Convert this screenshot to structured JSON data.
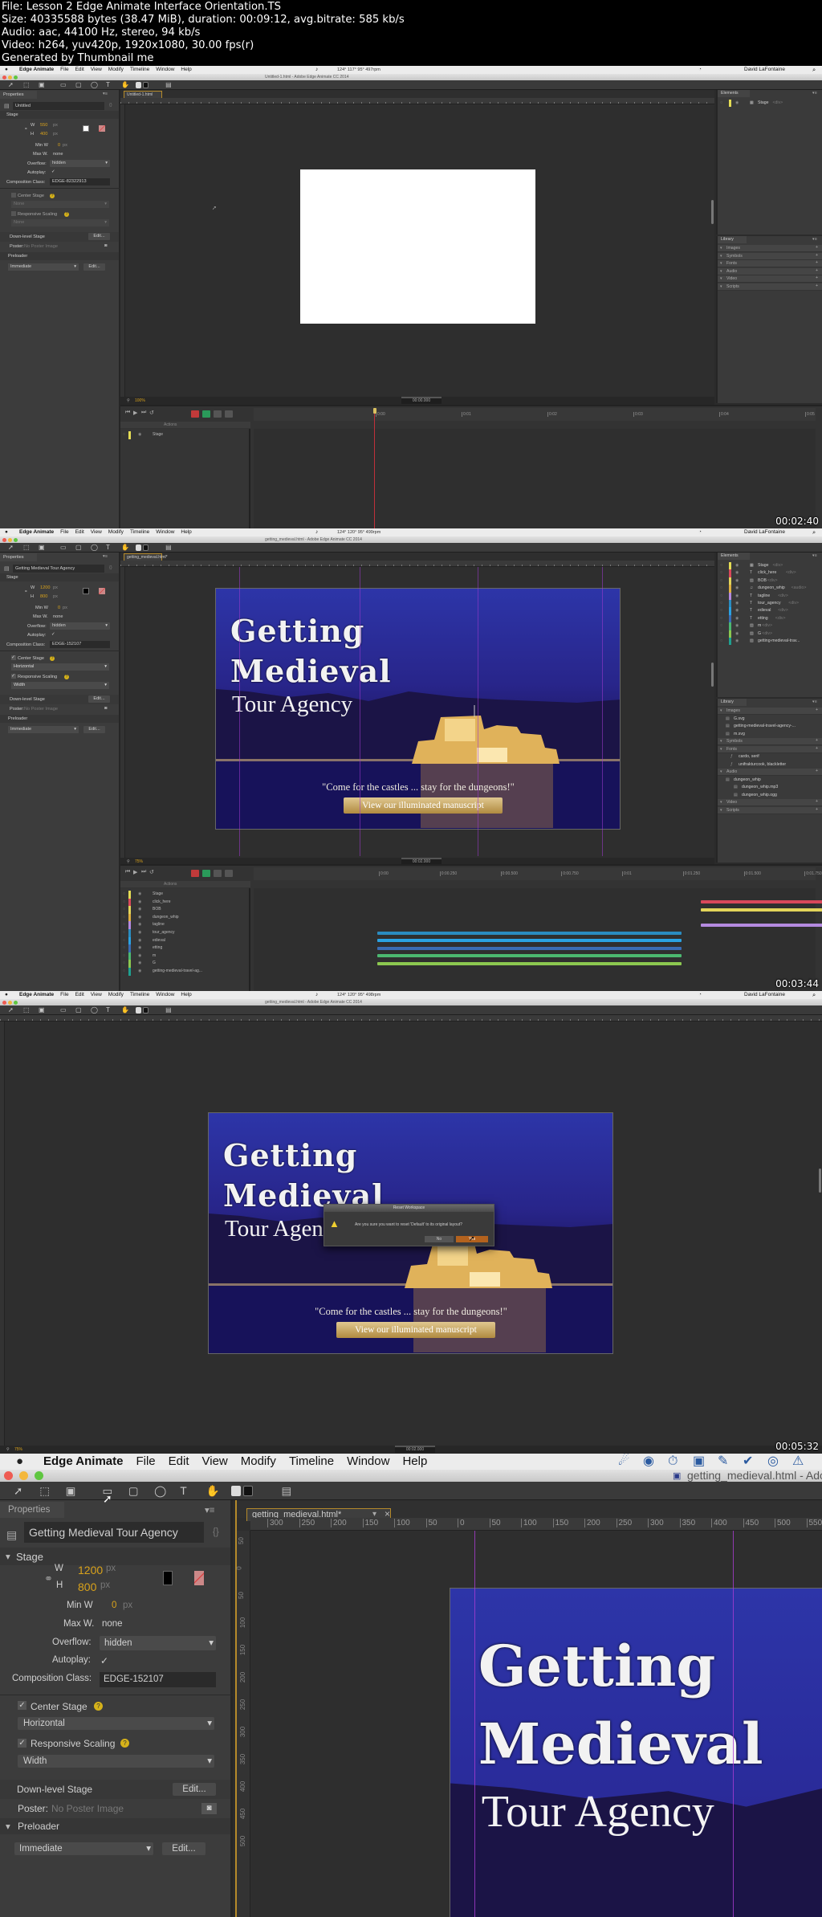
{
  "header": {
    "file": "File: Lesson 2 Edge Animate Interface Orientation.TS",
    "size": "Size: 40335588 bytes (38.47 MiB), duration: 00:09:12, avg.bitrate: 585 kb/s",
    "audio": "Audio: aac, 44100 Hz, stereo, 94 kb/s",
    "video": "Video: h264, yuv420p, 1920x1080, 30.00 fps(r)",
    "generator": "Generated by Thumbnail me"
  },
  "app": {
    "name": "Edge Animate",
    "menus": [
      "File",
      "Edit",
      "View",
      "Modify",
      "Timeline",
      "Window",
      "Help"
    ],
    "user": "David LaFontaine",
    "panel_properties": "Properties",
    "panel_elements": "Elements",
    "panel_library": "Library",
    "close_glyph": "×"
  },
  "labels": {
    "stage": "Stage",
    "w": "W",
    "h": "H",
    "px": "px",
    "min_w": "Min W",
    "max_w": "Max W.",
    "overflow": "Overflow:",
    "autoplay": "Autoplay:",
    "composition_class": "Composition Class:",
    "center_stage": "Center Stage",
    "responsive_scaling": "Responsive Scaling",
    "down_level_stage": "Down-level Stage",
    "poster": "Poster:",
    "no_poster": "No Poster Image",
    "preloader": "Preloader",
    "edit": "Edit...",
    "actions": "Actions",
    "check": "✓"
  },
  "stage_content": {
    "title_line1": "Getting",
    "title_line2": "Medieval",
    "subtitle": "Tour Agency",
    "tagline": "\"Come for the castles ... stay for the dungeons!\"",
    "button": "View our illuminated manuscript"
  },
  "colors": {
    "accent_orange": "#d9a21b",
    "guide_purple": "#a03ad0",
    "playhead_red": "#c0303a",
    "panel_bg": "#3c3c3c",
    "canvas_bg": "#2e2e2e"
  },
  "frames": [
    {
      "timestamp": "00:02:40",
      "status_readout": "124° 117° 95° 497rpm",
      "window_title": "Untitled-1.html - Adobe Edge Animate CC 2014",
      "doc_tab": "Untitled-1.html",
      "zoom": "100%",
      "time": "00:00.000",
      "properties": {
        "title": "Untitled",
        "w": "550",
        "h": "400",
        "min_w": "0",
        "max_w": "none",
        "overflow": "hidden",
        "autoplay": true,
        "composition_class": "EDGE-82322913",
        "center_stage": false,
        "center_stage_value": "None",
        "responsive_scaling": false,
        "responsive_scaling_value": "None",
        "preloader": "Immediate",
        "stage_color": "#ffffff"
      },
      "elements": [
        {
          "name": "Stage",
          "tag": "<div>",
          "color": "#e4dc55",
          "type": "stage"
        }
      ],
      "library": [
        {
          "label": "Images",
          "items": []
        },
        {
          "label": "Symbols",
          "items": []
        },
        {
          "label": "Fonts",
          "items": []
        },
        {
          "label": "Audio",
          "items": []
        },
        {
          "label": "Video",
          "items": []
        },
        {
          "label": "Scripts",
          "items": []
        }
      ],
      "timeline": {
        "ticks": [
          {
            "label": "0:00",
            "t": 0
          },
          {
            "label": "0:01",
            "t": 1
          },
          {
            "label": "0:02",
            "t": 2
          },
          {
            "label": "0:03",
            "t": 3
          },
          {
            "label": "0:04",
            "t": 4
          },
          {
            "label": "0:05",
            "t": 5
          },
          {
            "label": "0:06",
            "t": 6
          }
        ],
        "playhead": 0,
        "rows": [
          {
            "name": "Stage",
            "color": "#e4dc55",
            "bars": []
          }
        ]
      }
    },
    {
      "timestamp": "00:03:44",
      "status_readout": "124° 120° 95° 499rpm",
      "window_title": "getting_medieval.html - Adobe Edge Animate CC 2014",
      "doc_tab": "getting_medieval.html*",
      "zoom": "75%",
      "time": "00:02.000",
      "properties": {
        "title": "Getting Medieval Tour Agency",
        "w": "1200",
        "h": "800",
        "min_w": "0",
        "max_w": "none",
        "overflow": "hidden",
        "autoplay": true,
        "composition_class": "EDGE-152107",
        "center_stage": true,
        "center_stage_value": "Horizontal",
        "responsive_scaling": true,
        "responsive_scaling_value": "Width",
        "preloader": "Immediate",
        "stage_color": "#000000"
      },
      "elements": [
        {
          "name": "Stage",
          "tag": "<div>",
          "color": "#e4dc55",
          "type": "stage"
        },
        {
          "name": "click_here",
          "tag": "<div>",
          "color": "#d8485a",
          "type": "text"
        },
        {
          "name": "BOB",
          "tag": "<div>",
          "color": "#e2d45a",
          "type": "image"
        },
        {
          "name": "dungeon_whip",
          "tag": "<audio>",
          "color": "#e0b040",
          "type": "audio"
        },
        {
          "name": "tagline",
          "tag": "<div>",
          "color": "#b48ae0",
          "type": "text"
        },
        {
          "name": "tour_agency",
          "tag": "<div>",
          "color": "#2a8cc0",
          "type": "text"
        },
        {
          "name": "edieval",
          "tag": "<div>",
          "color": "#2aa2e2",
          "type": "text"
        },
        {
          "name": "etting",
          "tag": "<div>",
          "color": "#3a6cb4",
          "type": "text"
        },
        {
          "name": "m",
          "tag": "<div>",
          "color": "#4cb870",
          "type": "image"
        },
        {
          "name": "G",
          "tag": "<div>",
          "color": "#8cc850",
          "type": "image"
        },
        {
          "name": "getting-medieval-trav...",
          "tag": "",
          "color": "#1fa090",
          "type": "image"
        }
      ],
      "library": [
        {
          "label": "Images",
          "items": [
            "G.svg",
            "getting-medieval-travel-agency-...",
            "m.svg"
          ]
        },
        {
          "label": "Symbols",
          "items": []
        },
        {
          "label": "Fonts",
          "items": [
            "cardo, serif",
            "unifrakturcook, blackletter"
          ]
        },
        {
          "label": "Audio",
          "items": [
            "dungeon_whip",
            "dungeon_whip.mp3",
            "dungeon_whip.ogg"
          ]
        },
        {
          "label": "Video",
          "items": []
        },
        {
          "label": "Scripts",
          "items": []
        }
      ],
      "timeline": {
        "ticks": [
          {
            "label": "0:00",
            "t": 0
          },
          {
            "label": "0:00.250",
            "t": 0.25
          },
          {
            "label": "0:00.500",
            "t": 0.5
          },
          {
            "label": "0:00.750",
            "t": 0.75
          },
          {
            "label": "0:01",
            "t": 1
          },
          {
            "label": "0:01.250",
            "t": 1.25
          },
          {
            "label": "0:01.500",
            "t": 1.5
          },
          {
            "label": "0:01.750",
            "t": 1.75
          },
          {
            "label": "0:02",
            "t": 2
          }
        ],
        "playhead": 2,
        "rows": [
          {
            "name": "Stage",
            "color": "#e4dc55",
            "bars": []
          },
          {
            "name": "click_here",
            "color": "#d8485a",
            "bars": [
              [
                1.33,
                2.0
              ]
            ]
          },
          {
            "name": "BOB",
            "color": "#e2d45a",
            "bars": [
              [
                1.33,
                2.0
              ]
            ]
          },
          {
            "name": "dungeon_whip",
            "color": "#e0b040",
            "bars": []
          },
          {
            "name": "tagline",
            "color": "#b48ae0",
            "bars": [
              [
                1.33,
                2.0
              ]
            ]
          },
          {
            "name": "tour_agency",
            "color": "#2a8cc0",
            "bars": [
              [
                0,
                1.25
              ]
            ]
          },
          {
            "name": "edieval",
            "color": "#2aa2e2",
            "bars": [
              [
                0,
                1.25
              ]
            ]
          },
          {
            "name": "etting",
            "color": "#3a6cb4",
            "bars": [
              [
                0,
                1.25
              ]
            ]
          },
          {
            "name": "m",
            "color": "#4cb870",
            "bars": [
              [
                0,
                1.25
              ]
            ]
          },
          {
            "name": "G",
            "color": "#8cc850",
            "bars": [
              [
                0,
                1.25
              ]
            ]
          },
          {
            "name": "getting-medieval-travel-ag...",
            "color": "#1fa090",
            "bars": []
          }
        ]
      }
    },
    {
      "timestamp": "00:05:32",
      "status_readout": "124° 120° 95° 498rpm",
      "window_title": "getting_medieval.html - Adobe Edge Animate CC 2014",
      "zoom": "75%",
      "time": "00:02.000",
      "dialog": {
        "title": "Reset Workspace",
        "message": "Are you sure you want to reset 'Default' to its original layout?",
        "no": "No",
        "yes": "Yes"
      }
    },
    {
      "window_title": "getting_medieval.html - Adob",
      "doc_tab": "getting_medieval.html*",
      "ruler": [
        "300",
        "250",
        "200",
        "150",
        "100",
        "50",
        "0",
        "50",
        "100",
        "150",
        "200",
        "250",
        "300",
        "350",
        "400",
        "450",
        "500",
        "550"
      ],
      "ruler_v": [
        "50",
        "0",
        "50",
        "100",
        "150",
        "200",
        "250",
        "300",
        "350",
        "400",
        "450",
        "500"
      ],
      "properties": {
        "title": "Getting Medieval Tour Agency",
        "w": "1200",
        "h": "800",
        "min_w": "0",
        "max_w": "none",
        "overflow": "hidden",
        "autoplay": true,
        "composition_class": "EDGE-152107",
        "center_stage": true,
        "center_stage_value": "Horizontal",
        "responsive_scaling": true,
        "responsive_scaling_value": "Width",
        "preloader": "Immediate"
      }
    }
  ]
}
